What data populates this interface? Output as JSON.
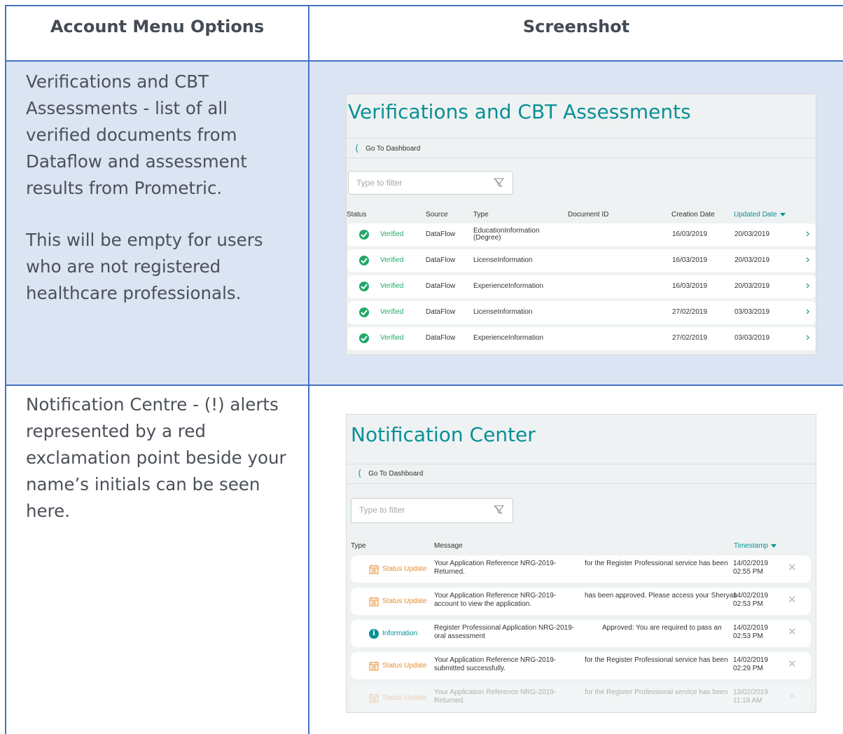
{
  "headers": {
    "left": "Account Menu Options",
    "right": "Screenshot"
  },
  "sections": [
    {
      "paragraphs": [
        "Verifications and CBT Assessments - list of all verified documents from Dataflow and assessment results from Prometric.",
        "This will be empty for users who are not registered healthcare professionals."
      ]
    },
    {
      "paragraphs": [
        "Notification Centre - (!) alerts represented by a red exclamation point beside your name’s initials can be seen here."
      ]
    }
  ],
  "verifications": {
    "title": "Verifications and CBT Assessments",
    "back_label": "Go To Dashboard",
    "filter_placeholder": "Type to filter",
    "columns": {
      "status": "Status",
      "source": "Source",
      "type": "Type",
      "document_id": "Document ID",
      "creation_date": "Creation Date",
      "updated_date": "Updated Date"
    },
    "rows": [
      {
        "status": "Verified",
        "source": "DataFlow",
        "type": "EducationInformation",
        "type2": "(Degree)",
        "created": "16/03/2019",
        "updated": "20/03/2019"
      },
      {
        "status": "Verified",
        "source": "DataFlow",
        "type": "LicenseInformation",
        "type2": "",
        "created": "16/03/2019",
        "updated": "20/03/2019"
      },
      {
        "status": "Verified",
        "source": "DataFlow",
        "type": "ExperienceInformation",
        "type2": "",
        "created": "16/03/2019",
        "updated": "20/03/2019"
      },
      {
        "status": "Verified",
        "source": "DataFlow",
        "type": "LicenseInformation",
        "type2": "",
        "created": "27/02/2019",
        "updated": "03/03/2019"
      },
      {
        "status": "Verified",
        "source": "DataFlow",
        "type": "ExperienceInformation",
        "type2": "",
        "created": "27/02/2019",
        "updated": "03/03/2019"
      }
    ]
  },
  "notifications": {
    "title": "Notification Center",
    "back_label": "Go To Dashboard",
    "filter_placeholder": "Type to filter",
    "columns": {
      "type": "Type",
      "message": "Message",
      "timestamp": "Timestamp"
    },
    "rows": [
      {
        "type": "Status Update",
        "msg1": "Your Application Reference NRG-2019-",
        "msg2": "Returned.",
        "msg3": "for the Register Professional service has been",
        "date": "14/02/2019",
        "time": "02:55 PM"
      },
      {
        "type": "Status Update",
        "msg1": "Your Application Reference NRG-2019-",
        "msg2": "account to view the application.",
        "msg3": "has been approved. Please access your Sheryan",
        "date": "14/02/2019",
        "time": "02:53 PM"
      },
      {
        "type": "Information",
        "msg1": "Register Professional Application NRG-2019-",
        "msg2": "oral assessment",
        "msg3": "Approved: You are required to pass an",
        "date": "14/02/2019",
        "time": "02:53 PM"
      },
      {
        "type": "Status Update",
        "msg1": "Your Application Reference NRG-2019-",
        "msg2": "submitted successfully.",
        "msg3": "for the Register Professional service has been",
        "date": "14/02/2019",
        "time": "02:29 PM"
      },
      {
        "type": "Status Update",
        "msg1": "Your Application Reference NRG-2019-",
        "msg2": "Returned.",
        "msg3": "for the Register Professional service has been",
        "date": "13/02/2019",
        "time": "11:18 AM"
      }
    ]
  },
  "colors": {
    "accent": "#0a8f96",
    "verified": "#1fa968",
    "status_update": "#ea8a2a",
    "section_bg": "#dbe4f2",
    "grid_line": "#4472c4"
  }
}
